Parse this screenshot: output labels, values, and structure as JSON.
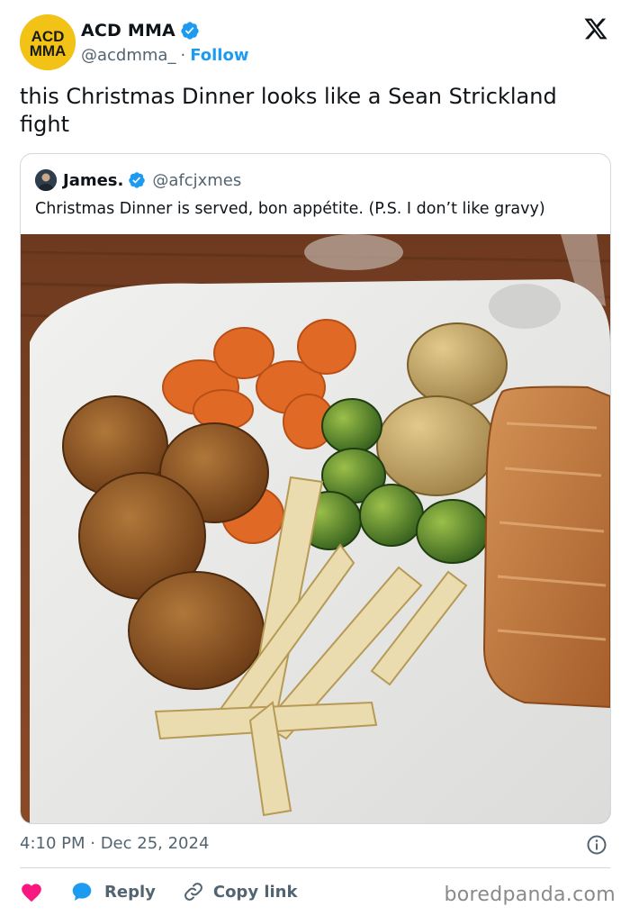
{
  "author": {
    "name": "ACD MMA",
    "handle": "@acdmma_",
    "separator": "·",
    "follow_label": "Follow",
    "avatar_text_top": "ACD",
    "avatar_text_bottom": "MMA",
    "avatar_color": "#f2c316"
  },
  "tweet": {
    "text": "this Christmas Dinner looks like a Sean Strickland fight",
    "timestamp": "4:10 PM · Dec 25, 2024"
  },
  "quoted": {
    "name": "James.",
    "handle": "@afcjxmes",
    "text": "Christmas Dinner is served, bon appétite. (P.S. I don’t like gravy)"
  },
  "actions": {
    "reply_label": "Reply",
    "copy_label": "Copy link"
  },
  "icons": {
    "logo": "x-logo-icon",
    "verified": "verified-badge-icon",
    "info": "info-icon",
    "heart": "heart-icon",
    "reply": "reply-bubble-icon",
    "link": "link-icon"
  },
  "colors": {
    "accent": "#1d9bf0",
    "heart": "#f91880",
    "muted": "#536471"
  },
  "watermark": "boredpanda.com"
}
